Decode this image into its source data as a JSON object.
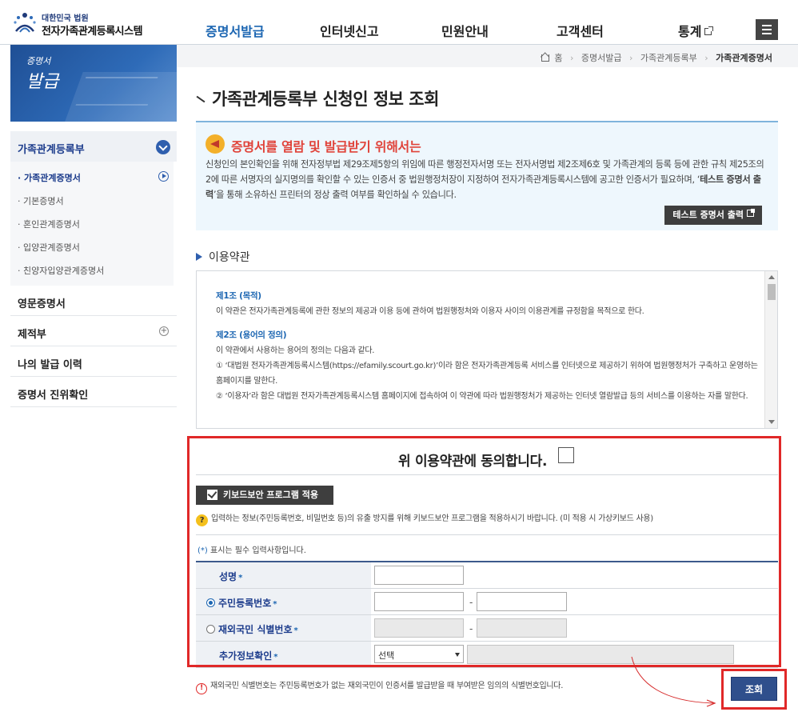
{
  "header": {
    "court": "대한민국 법원",
    "system": "전자가족관계등록시스템",
    "nav": [
      {
        "label": "증명서발급",
        "active": true
      },
      {
        "label": "인터넷신고",
        "active": false
      },
      {
        "label": "민원안내",
        "active": false
      },
      {
        "label": "고객센터",
        "active": false
      },
      {
        "label": "통계",
        "active": false
      }
    ]
  },
  "side": {
    "banner_small": "증명서",
    "banner_big": "발급",
    "group": "가족관계등록부",
    "subitems": [
      "· 가족관계증명서",
      "· 기본증명서",
      "· 혼인관계증명서",
      "· 입양관계증명서",
      "· 친양자입양관계증명서"
    ],
    "items": [
      "영문증명서",
      "제적부",
      "나의 발급 이력",
      "증명서 진위확인"
    ],
    "plus": "+"
  },
  "breadcrumb": [
    "홈",
    "증명서발급",
    "가족관계등록부",
    "가족관계증명서"
  ],
  "page_title": "가족관계등록부 신청인 정보 조회",
  "notice": {
    "title": "증명서를 열람 및 발급받기 위해서는",
    "body_pre": "신청인의 본인확인을 위해 전자정부법 제29조제5항의 위임에 따른 행정전자서명 또는 전자서명법 제2조제6호 및 가족관계의 등록 등에 관한 규칙 제25조의 2에 따른 서명자의 실지명의를 확인할 수 있는 인증서 중 법원행정처장이 지정하여 전자가족관계등록시스템에 공고한 인증서가 필요하며, ‘",
    "body_bold": "테스트 증명서 출력",
    "body_post": "’을 통해 소유하신 프린터의 정상 출력 여부를 확인하실 수 있습니다.",
    "test_button": "테스트 증명서 출력"
  },
  "terms": {
    "section_title": "이용약관",
    "art1_title": "제1조 (목적)",
    "art1_body": "이 약관은 전자가족관계등록에 관한 정보의 제공과 이용 등에 관하여 법원행정처와 이용자 사이의 이용관계를 규정함을 목적으로 한다.",
    "art2_title": "제2조 (용어의 정의)",
    "art2_body": "이 약관에서 사용하는 용어의 정의는 다음과 같다.",
    "art2_item1": "① ‘대법원 전자가족관계등록시스템(https://efamily.scourt.go.kr)’이라 함은 전자가족관계등록 서비스를 인터넷으로 제공하기 위하여 법원행정처가 구축하고 운영하는 홈페이지를 말한다.",
    "art2_item2": "② ‘이용자’라 함은 대법원 전자가족관계등록시스템 홈페이지에 접속하여 이 약관에 따라 법원행정처가 제공하는 인터넷 열람발급 등의 서비스를 이용하는 자를 말한다."
  },
  "agree": "위 이용약관에 동의합니다.",
  "keyboard": {
    "button": "키보드보안 프로그램 적용",
    "q": "?",
    "note": "입력하는 정보(주민등록번호, 비밀번호 등)의 유출 방지를 위해 키보드보안 프로그램을 적용하시기 바랍니다. (미 적용 시 가상키보드 사용)"
  },
  "required_note": "표시는 필수 입력사항입니다.",
  "required_star": "(*)",
  "form": {
    "star": "*",
    "name_label": "성명",
    "rrn_label": "주민등록번호",
    "foreign_label": "재외국민 식별번호",
    "extra_label": "추가정보확인",
    "dash": "-",
    "select_value": "선택"
  },
  "warning": {
    "icon": "!",
    "text": "재외국민 식별번호는 주민등록번호가 없는 재외국민이 인증서를 발급받을 때 부여받은 임의의 식별번호입니다."
  },
  "search_button": "조회",
  "colors": {
    "accent": "#1c66b2",
    "highlight": "#e02828",
    "notice_title": "#e0433a"
  }
}
